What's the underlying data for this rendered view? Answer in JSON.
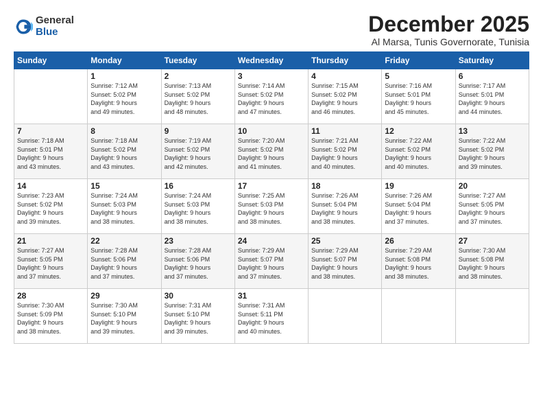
{
  "logo": {
    "general": "General",
    "blue": "Blue"
  },
  "title": "December 2025",
  "subtitle": "Al Marsa, Tunis Governorate, Tunisia",
  "header_days": [
    "Sunday",
    "Monday",
    "Tuesday",
    "Wednesday",
    "Thursday",
    "Friday",
    "Saturday"
  ],
  "weeks": [
    [
      {
        "day": "",
        "info": ""
      },
      {
        "day": "1",
        "info": "Sunrise: 7:12 AM\nSunset: 5:02 PM\nDaylight: 9 hours\nand 49 minutes."
      },
      {
        "day": "2",
        "info": "Sunrise: 7:13 AM\nSunset: 5:02 PM\nDaylight: 9 hours\nand 48 minutes."
      },
      {
        "day": "3",
        "info": "Sunrise: 7:14 AM\nSunset: 5:02 PM\nDaylight: 9 hours\nand 47 minutes."
      },
      {
        "day": "4",
        "info": "Sunrise: 7:15 AM\nSunset: 5:02 PM\nDaylight: 9 hours\nand 46 minutes."
      },
      {
        "day": "5",
        "info": "Sunrise: 7:16 AM\nSunset: 5:01 PM\nDaylight: 9 hours\nand 45 minutes."
      },
      {
        "day": "6",
        "info": "Sunrise: 7:17 AM\nSunset: 5:01 PM\nDaylight: 9 hours\nand 44 minutes."
      }
    ],
    [
      {
        "day": "7",
        "info": "Sunrise: 7:18 AM\nSunset: 5:01 PM\nDaylight: 9 hours\nand 43 minutes."
      },
      {
        "day": "8",
        "info": "Sunrise: 7:18 AM\nSunset: 5:02 PM\nDaylight: 9 hours\nand 43 minutes."
      },
      {
        "day": "9",
        "info": "Sunrise: 7:19 AM\nSunset: 5:02 PM\nDaylight: 9 hours\nand 42 minutes."
      },
      {
        "day": "10",
        "info": "Sunrise: 7:20 AM\nSunset: 5:02 PM\nDaylight: 9 hours\nand 41 minutes."
      },
      {
        "day": "11",
        "info": "Sunrise: 7:21 AM\nSunset: 5:02 PM\nDaylight: 9 hours\nand 40 minutes."
      },
      {
        "day": "12",
        "info": "Sunrise: 7:22 AM\nSunset: 5:02 PM\nDaylight: 9 hours\nand 40 minutes."
      },
      {
        "day": "13",
        "info": "Sunrise: 7:22 AM\nSunset: 5:02 PM\nDaylight: 9 hours\nand 39 minutes."
      }
    ],
    [
      {
        "day": "14",
        "info": "Sunrise: 7:23 AM\nSunset: 5:02 PM\nDaylight: 9 hours\nand 39 minutes."
      },
      {
        "day": "15",
        "info": "Sunrise: 7:24 AM\nSunset: 5:03 PM\nDaylight: 9 hours\nand 38 minutes."
      },
      {
        "day": "16",
        "info": "Sunrise: 7:24 AM\nSunset: 5:03 PM\nDaylight: 9 hours\nand 38 minutes."
      },
      {
        "day": "17",
        "info": "Sunrise: 7:25 AM\nSunset: 5:03 PM\nDaylight: 9 hours\nand 38 minutes."
      },
      {
        "day": "18",
        "info": "Sunrise: 7:26 AM\nSunset: 5:04 PM\nDaylight: 9 hours\nand 38 minutes."
      },
      {
        "day": "19",
        "info": "Sunrise: 7:26 AM\nSunset: 5:04 PM\nDaylight: 9 hours\nand 37 minutes."
      },
      {
        "day": "20",
        "info": "Sunrise: 7:27 AM\nSunset: 5:05 PM\nDaylight: 9 hours\nand 37 minutes."
      }
    ],
    [
      {
        "day": "21",
        "info": "Sunrise: 7:27 AM\nSunset: 5:05 PM\nDaylight: 9 hours\nand 37 minutes."
      },
      {
        "day": "22",
        "info": "Sunrise: 7:28 AM\nSunset: 5:06 PM\nDaylight: 9 hours\nand 37 minutes."
      },
      {
        "day": "23",
        "info": "Sunrise: 7:28 AM\nSunset: 5:06 PM\nDaylight: 9 hours\nand 37 minutes."
      },
      {
        "day": "24",
        "info": "Sunrise: 7:29 AM\nSunset: 5:07 PM\nDaylight: 9 hours\nand 37 minutes."
      },
      {
        "day": "25",
        "info": "Sunrise: 7:29 AM\nSunset: 5:07 PM\nDaylight: 9 hours\nand 38 minutes."
      },
      {
        "day": "26",
        "info": "Sunrise: 7:29 AM\nSunset: 5:08 PM\nDaylight: 9 hours\nand 38 minutes."
      },
      {
        "day": "27",
        "info": "Sunrise: 7:30 AM\nSunset: 5:08 PM\nDaylight: 9 hours\nand 38 minutes."
      }
    ],
    [
      {
        "day": "28",
        "info": "Sunrise: 7:30 AM\nSunset: 5:09 PM\nDaylight: 9 hours\nand 38 minutes."
      },
      {
        "day": "29",
        "info": "Sunrise: 7:30 AM\nSunset: 5:10 PM\nDaylight: 9 hours\nand 39 minutes."
      },
      {
        "day": "30",
        "info": "Sunrise: 7:31 AM\nSunset: 5:10 PM\nDaylight: 9 hours\nand 39 minutes."
      },
      {
        "day": "31",
        "info": "Sunrise: 7:31 AM\nSunset: 5:11 PM\nDaylight: 9 hours\nand 40 minutes."
      },
      {
        "day": "",
        "info": ""
      },
      {
        "day": "",
        "info": ""
      },
      {
        "day": "",
        "info": ""
      }
    ]
  ]
}
